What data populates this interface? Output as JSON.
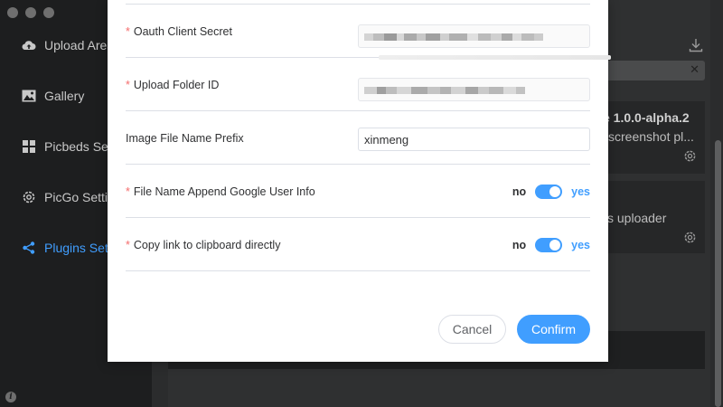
{
  "sidebar": {
    "items": [
      {
        "label": "Upload Area",
        "icon": "cloud-upload-icon",
        "active": false
      },
      {
        "label": "Gallery",
        "icon": "image-icon",
        "active": false
      },
      {
        "label": "Picbeds Settings",
        "icon": "grid-icon",
        "active": false
      },
      {
        "label": "PicGo Settings",
        "icon": "gear-icon",
        "active": false
      },
      {
        "label": "Plugins Settings",
        "icon": "share-icon",
        "active": true
      }
    ]
  },
  "plugins": {
    "title_fragment": "e 1.0.0-alpha.2",
    "desc_fragment": "screenshot pl...",
    "desc2_fragment": "s uploader"
  },
  "dialog": {
    "fields": [
      {
        "label": "Oauth Client Secret",
        "required": true,
        "type": "masked"
      },
      {
        "label": "Upload Folder ID",
        "required": true,
        "type": "masked"
      },
      {
        "label": "Image File Name Prefix",
        "required": false,
        "type": "text",
        "value": "xinmeng"
      },
      {
        "label": "File Name Append Google User Info",
        "required": true,
        "type": "switch",
        "off_label": "no",
        "on_label": "yes",
        "value": true
      },
      {
        "label": "Copy link to clipboard directly",
        "required": true,
        "type": "switch",
        "off_label": "no",
        "on_label": "yes",
        "value": true
      }
    ],
    "required_mark": "*",
    "cancel_label": "Cancel",
    "confirm_label": "Confirm"
  },
  "colors": {
    "accent": "#409eff",
    "required": "#f56c6c",
    "sidebar_bg": "#1d1e1f"
  }
}
